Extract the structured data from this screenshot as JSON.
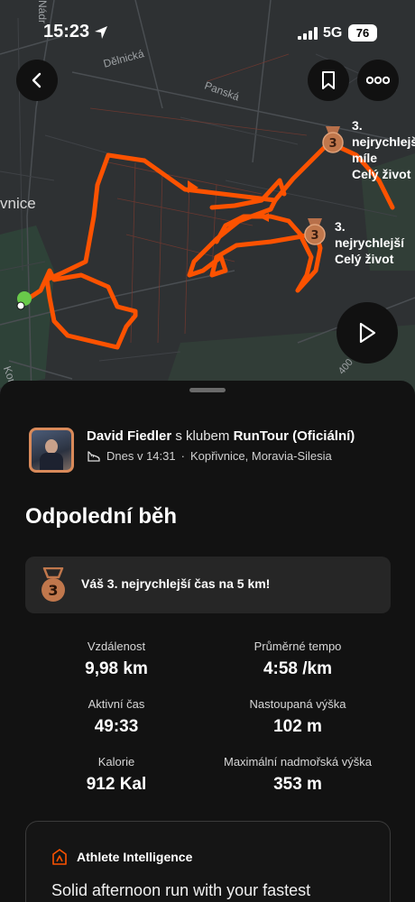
{
  "status_bar": {
    "time": "15:23",
    "network": "5G",
    "battery": "76"
  },
  "map": {
    "place_label": "vnice",
    "streets": [
      "Nádr",
      "Dělnická",
      "Panská",
      "Kom",
      "400 m"
    ],
    "route_color": "#fc5200",
    "personal_records": [
      {
        "line1": "3. nejrychlejší",
        "line2": "míle",
        "line3": "Celý život"
      },
      {
        "line1": "3. nejrychlejší",
        "line2": "Celý život"
      }
    ]
  },
  "header_buttons": {
    "back": "back-icon",
    "bookmark": "bookmark-icon",
    "more": "more-icon",
    "play": "play-icon"
  },
  "activity": {
    "athlete_name": "David Fiedler",
    "club_connector": "s klubem",
    "club_name": "RunTour (Oficiální)",
    "date": "Dnes v 14:31",
    "separator": "·",
    "location": "Kopřivnice, Moravia-Silesia",
    "title": "Odpolední běh"
  },
  "achievement": {
    "medal_number": "3",
    "text": "Váš 3. nejrychlejší čas na 5 km!"
  },
  "stats": [
    {
      "label": "Vzdálenost",
      "value": "9,98 km"
    },
    {
      "label": "Průměrné tempo",
      "value": "4:58 /km"
    },
    {
      "label": "Aktivní čas",
      "value": "49:33"
    },
    {
      "label": "Nastoupaná výška",
      "value": "102 m"
    },
    {
      "label": "Kalorie",
      "value": "912 Kal"
    },
    {
      "label": "Maximální nadmořská výška",
      "value": "353 m"
    }
  ],
  "athlete_intelligence": {
    "title": "Athlete Intelligence",
    "summary": "Solid afternoon run with your fastest"
  }
}
